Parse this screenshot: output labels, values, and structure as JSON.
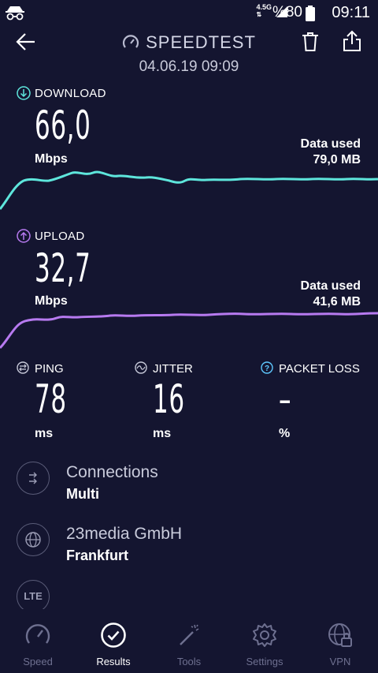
{
  "status_bar": {
    "network": "4.5G",
    "battery": "%80",
    "time": "09:11"
  },
  "header": {
    "title": "SPEEDTEST",
    "timestamp": "04.06.19 09:09"
  },
  "download": {
    "label": "DOWNLOAD",
    "value": "66,0",
    "unit": "Mbps",
    "data_used_label": "Data used",
    "data_used_value": "79,0 MB",
    "color": "#5ee6dc"
  },
  "upload": {
    "label": "UPLOAD",
    "value": "32,7",
    "unit": "Mbps",
    "data_used_label": "Data used",
    "data_used_value": "41,6 MB",
    "color": "#b77af0"
  },
  "metrics": {
    "ping": {
      "label": "PING",
      "value": "78",
      "unit": "ms"
    },
    "jitter": {
      "label": "JITTER",
      "value": "16",
      "unit": "ms"
    },
    "packet_loss": {
      "label": "PACKET LOSS",
      "value": "–",
      "unit": "%"
    }
  },
  "details": {
    "connections": {
      "title": "Connections",
      "value": "Multi"
    },
    "provider": {
      "title": "23media GmbH",
      "value": "Frankfurt"
    },
    "network_badge": "LTE"
  },
  "nav": {
    "items": [
      {
        "label": "Speed",
        "icon": "speedometer-icon",
        "active": false
      },
      {
        "label": "Results",
        "icon": "check-circle-icon",
        "active": true
      },
      {
        "label": "Tools",
        "icon": "magic-wand-icon",
        "active": false
      },
      {
        "label": "Settings",
        "icon": "gear-icon",
        "active": false
      },
      {
        "label": "VPN",
        "icon": "globe-lock-icon",
        "active": false
      }
    ]
  }
}
